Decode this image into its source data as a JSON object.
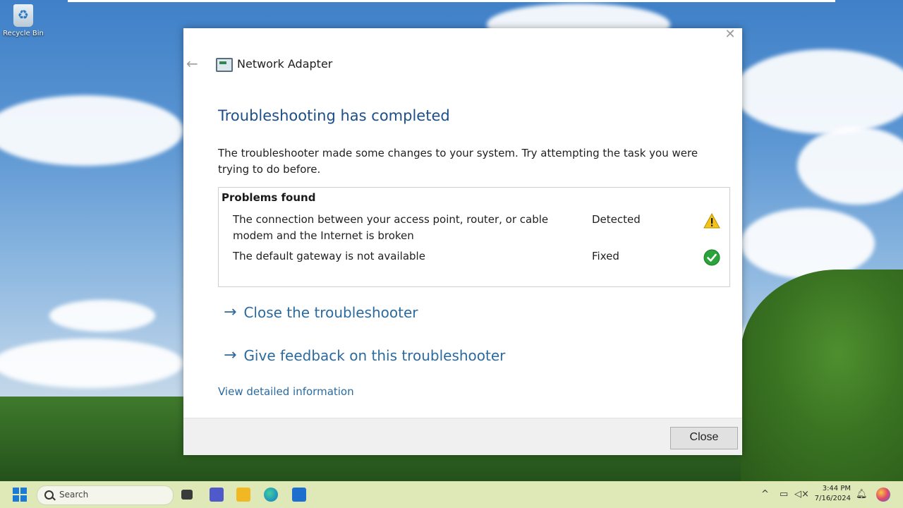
{
  "desktop": {
    "recycle_bin_label": "Recycle Bin"
  },
  "dialog": {
    "header_title": "Network Adapter",
    "close_glyph": "✕",
    "back_glyph": "←",
    "main_title": "Troubleshooting has completed",
    "description": "The troubleshooter made some changes to your system. Try attempting the task you were trying to do before.",
    "problems": {
      "title": "Problems found",
      "items": [
        {
          "text": "The connection between your access point, router, or cable modem and the Internet is broken",
          "status": "Detected",
          "icon": "warning-icon"
        },
        {
          "text": "The default gateway is not available",
          "status": "Fixed",
          "icon": "check-icon"
        }
      ]
    },
    "links": {
      "close_troubleshooter": "Close the troubleshooter",
      "give_feedback": "Give feedback on this troubleshooter",
      "view_details": "View detailed information"
    },
    "arrow_glyph": "→",
    "close_button_label": "Close"
  },
  "taskbar": {
    "search_placeholder": "Search",
    "time": "3:44 PM",
    "date": "7/16/2024"
  },
  "colors": {
    "title_blue": "#1c4f8a",
    "link_blue": "#2b6a9f",
    "taskbar_bg": "#dfe9b8",
    "warning_yellow": "#f3c31a",
    "success_green": "#2aa33a"
  }
}
